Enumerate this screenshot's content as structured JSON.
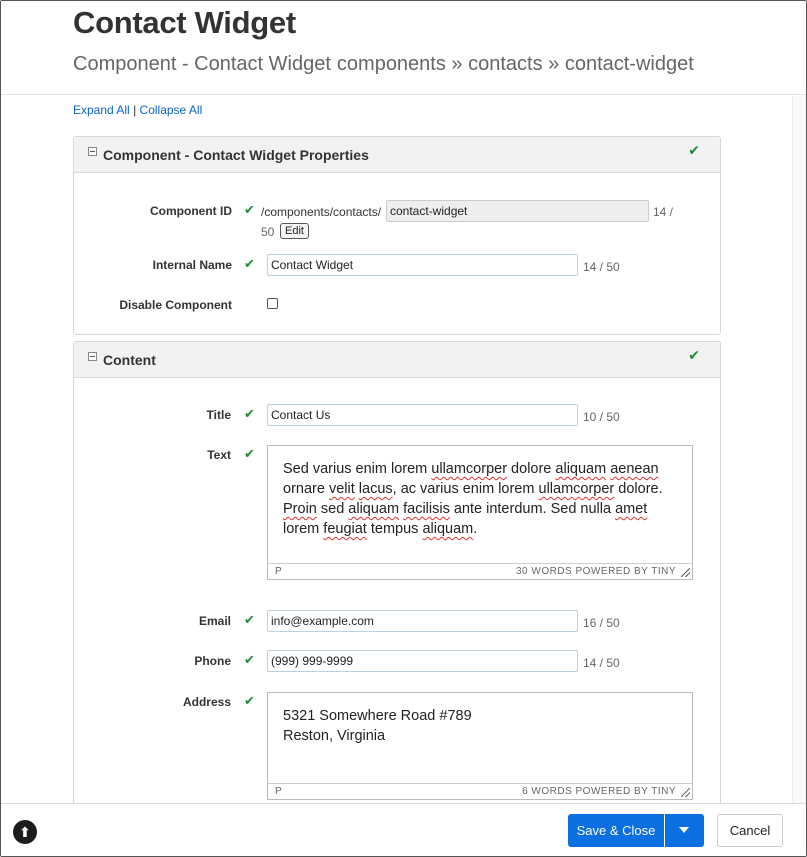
{
  "header": {
    "title": "Contact Widget",
    "subtitle_type": "Component - Contact Widget",
    "subtitle_path": "components » contacts » contact-widget"
  },
  "toolbar": {
    "expand_all": "Expand All",
    "separator": "|",
    "collapse_all": "Collapse All"
  },
  "panels": {
    "properties": {
      "title": "Component - Contact Widget Properties",
      "component_id": {
        "label": "Component ID",
        "path_prefix": "/components/contacts/",
        "value": "contact-widget",
        "count_a": "14 /",
        "count_b": "50",
        "edit_label": "Edit"
      },
      "internal_name": {
        "label": "Internal Name",
        "value": "Contact Widget",
        "count": "14 / 50"
      },
      "disable_component": {
        "label": "Disable Component",
        "checked": false
      }
    },
    "content": {
      "title": "Content",
      "title_field": {
        "label": "Title",
        "value": "Contact Us",
        "count": "10 / 50"
      },
      "text_field": {
        "label": "Text",
        "status_p": "P",
        "status_words": "30 WORDS  POWERED BY TINY"
      },
      "email_field": {
        "label": "Email",
        "value": "info@example.com",
        "count": "16 / 50"
      },
      "phone_field": {
        "label": "Phone",
        "value": "(999) 999-9999",
        "count": "14 / 50"
      },
      "address_field": {
        "label": "Address",
        "line1": "5321 Somewhere Road #789",
        "line2": "Reston, Virginia",
        "status_p": "P",
        "status_words": "6 WORDS  POWERED BY TINY"
      }
    }
  },
  "text_body": {
    "s1": "Sed varius enim lorem ",
    "s2": "ullamcorper",
    "s3": " dolore ",
    "s4": "aliquam",
    "s5": " ",
    "s6": "aenean",
    "s7": " ornare ",
    "s8": "velit",
    "s9": " ",
    "s10": "lacus",
    "s11": ", ac varius enim lorem ",
    "s12": "ullamcorper",
    "s13": " dolore. ",
    "s14": "Proin",
    "s15": " sed ",
    "s16": "aliquam",
    "s17": " ",
    "s18": "facilisis",
    "s19": " ante interdum. Sed nulla ",
    "s20": "amet",
    "s21": " lorem ",
    "s22": "feugiat",
    "s23": " tempus ",
    "s24": "aliquam",
    "s25": "."
  },
  "footer": {
    "help_icon_glyph": "⬆",
    "save_label": "Save & Close",
    "cancel_label": "Cancel"
  },
  "colors": {
    "accent": "#0a6fe0",
    "link": "#0b63c9",
    "check": "#1f8a3b"
  }
}
